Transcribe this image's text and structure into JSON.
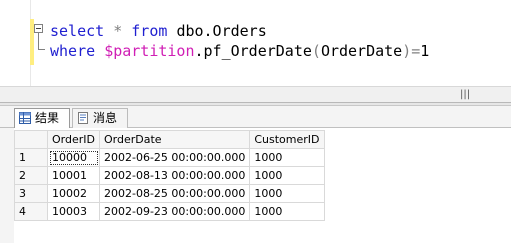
{
  "editor": {
    "lines": [
      {
        "kw1": "select",
        "star": "*",
        "kw2": "from",
        "table": "dbo.Orders"
      },
      {
        "kw": "where",
        "fn": "$partition",
        "obj": ".pf_OrderDate",
        "open": "(",
        "col": "OrderDate",
        "close": ")=",
        "num": "1"
      }
    ]
  },
  "scroll": {
    "grip": "|||"
  },
  "tabs": [
    {
      "label": "结果",
      "icon": "grid-icon"
    },
    {
      "label": "消息",
      "icon": "message-icon"
    }
  ],
  "grid": {
    "columns": [
      "OrderID",
      "OrderDate",
      "CustomerID"
    ],
    "rows": [
      {
        "n": "1",
        "OrderID": "10000",
        "OrderDate": "2002-06-25 00:00:00.000",
        "CustomerID": "1000"
      },
      {
        "n": "2",
        "OrderID": "10001",
        "OrderDate": "2002-08-13 00:00:00.000",
        "CustomerID": "1000"
      },
      {
        "n": "3",
        "OrderID": "10002",
        "OrderDate": "2002-08-25 00:00:00.000",
        "CustomerID": "1000"
      },
      {
        "n": "4",
        "OrderID": "10003",
        "OrderDate": "2002-09-23 00:00:00.000",
        "CustomerID": "1000"
      }
    ]
  }
}
